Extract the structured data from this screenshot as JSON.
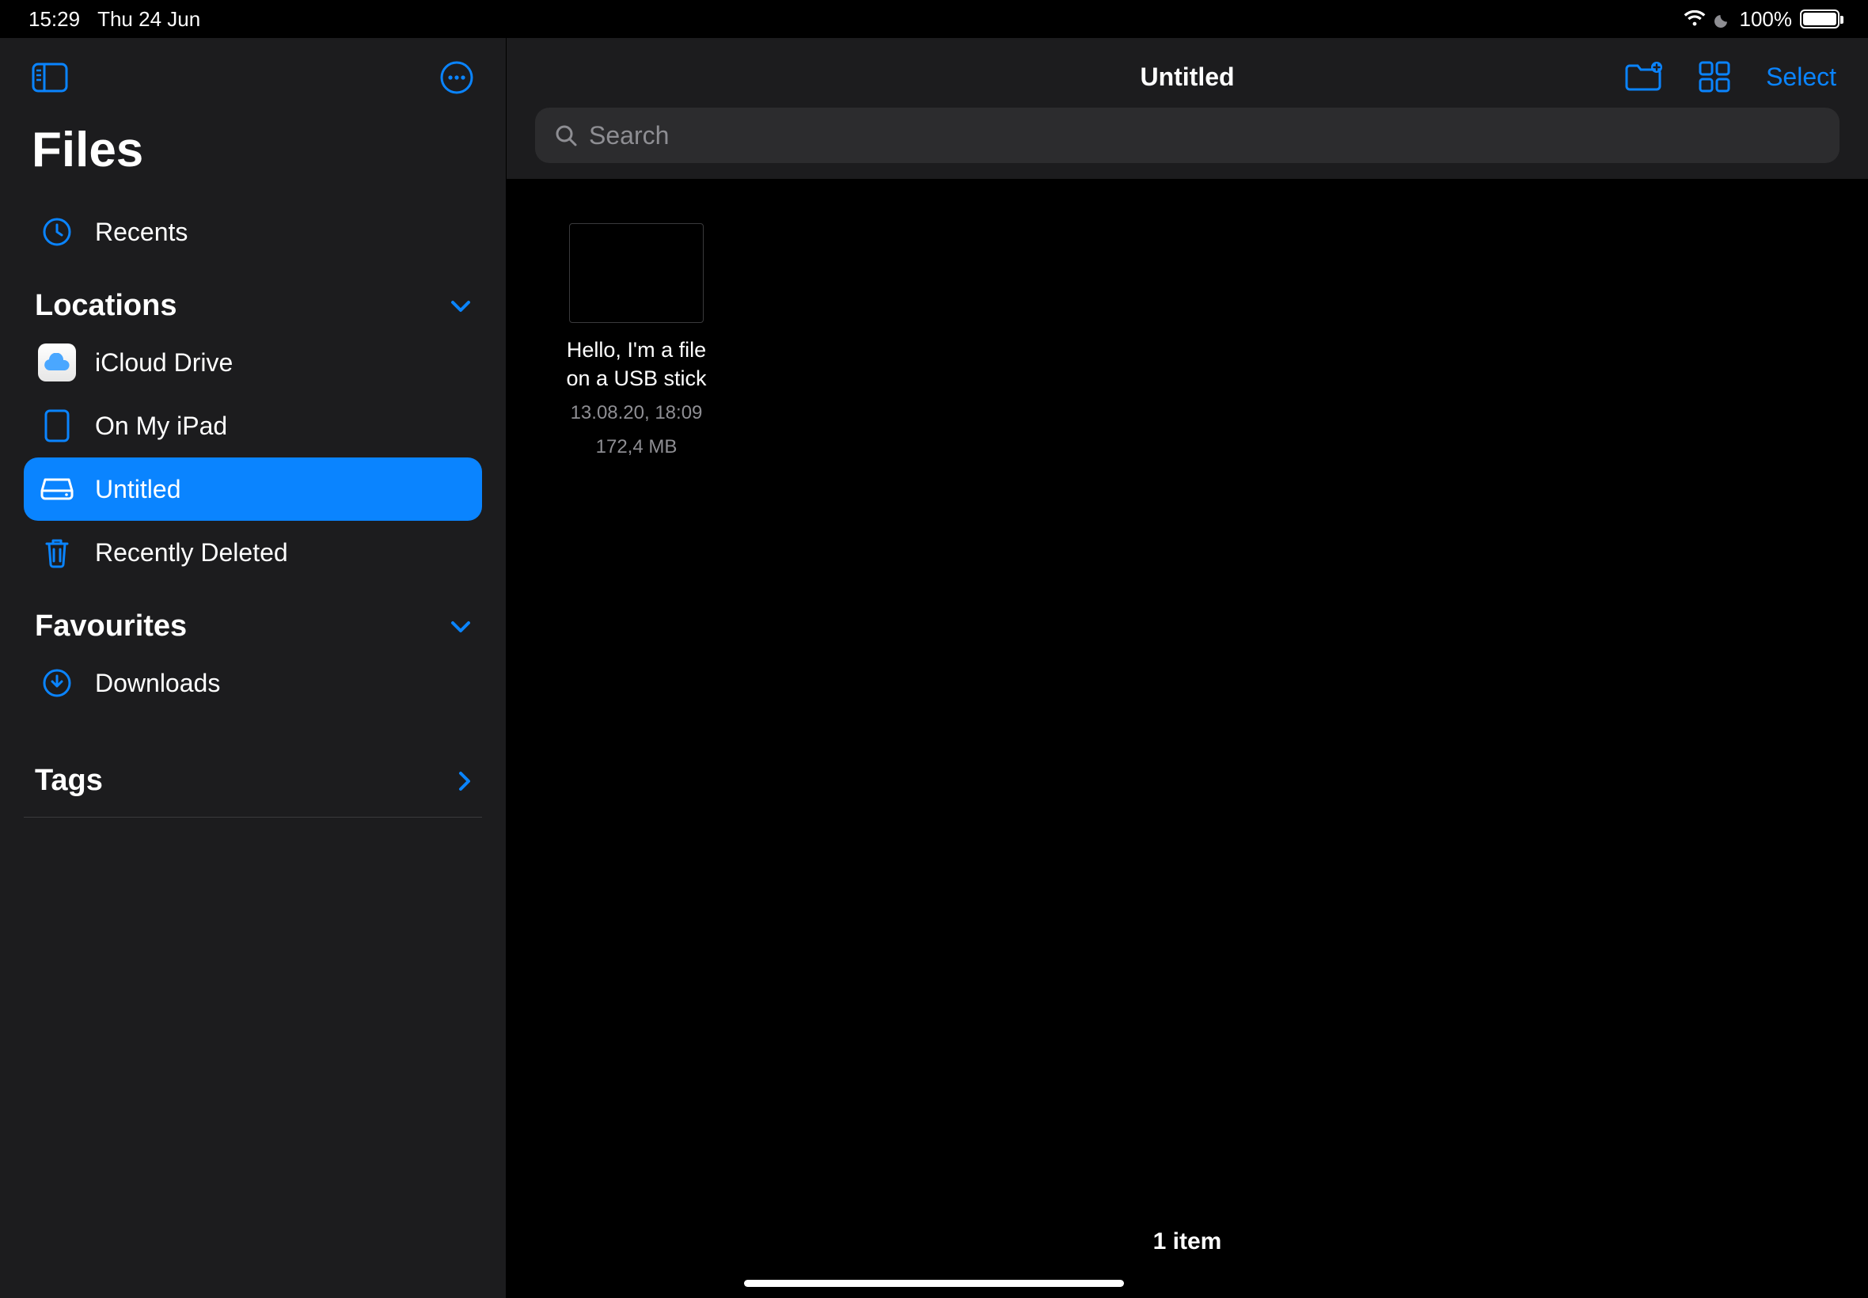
{
  "status": {
    "time": "15:29",
    "date": "Thu 24 Jun",
    "battery_percent": "100%"
  },
  "sidebar": {
    "title": "Files",
    "recents_label": "Recents",
    "sections": {
      "locations_label": "Locations",
      "favourites_label": "Favourites",
      "tags_label": "Tags"
    },
    "locations": {
      "icloud": "iCloud Drive",
      "onmyipad": "On My iPad",
      "untitled": "Untitled",
      "recently_deleted": "Recently Deleted"
    },
    "favourites": {
      "downloads": "Downloads"
    }
  },
  "header": {
    "title": "Untitled",
    "select_label": "Select"
  },
  "search": {
    "placeholder": "Search"
  },
  "files": [
    {
      "name": "Hello, I'm a file on a USB stick",
      "date": "13.08.20, 18:09",
      "size": "172,4 MB"
    }
  ],
  "footer": {
    "count": "1 item"
  }
}
